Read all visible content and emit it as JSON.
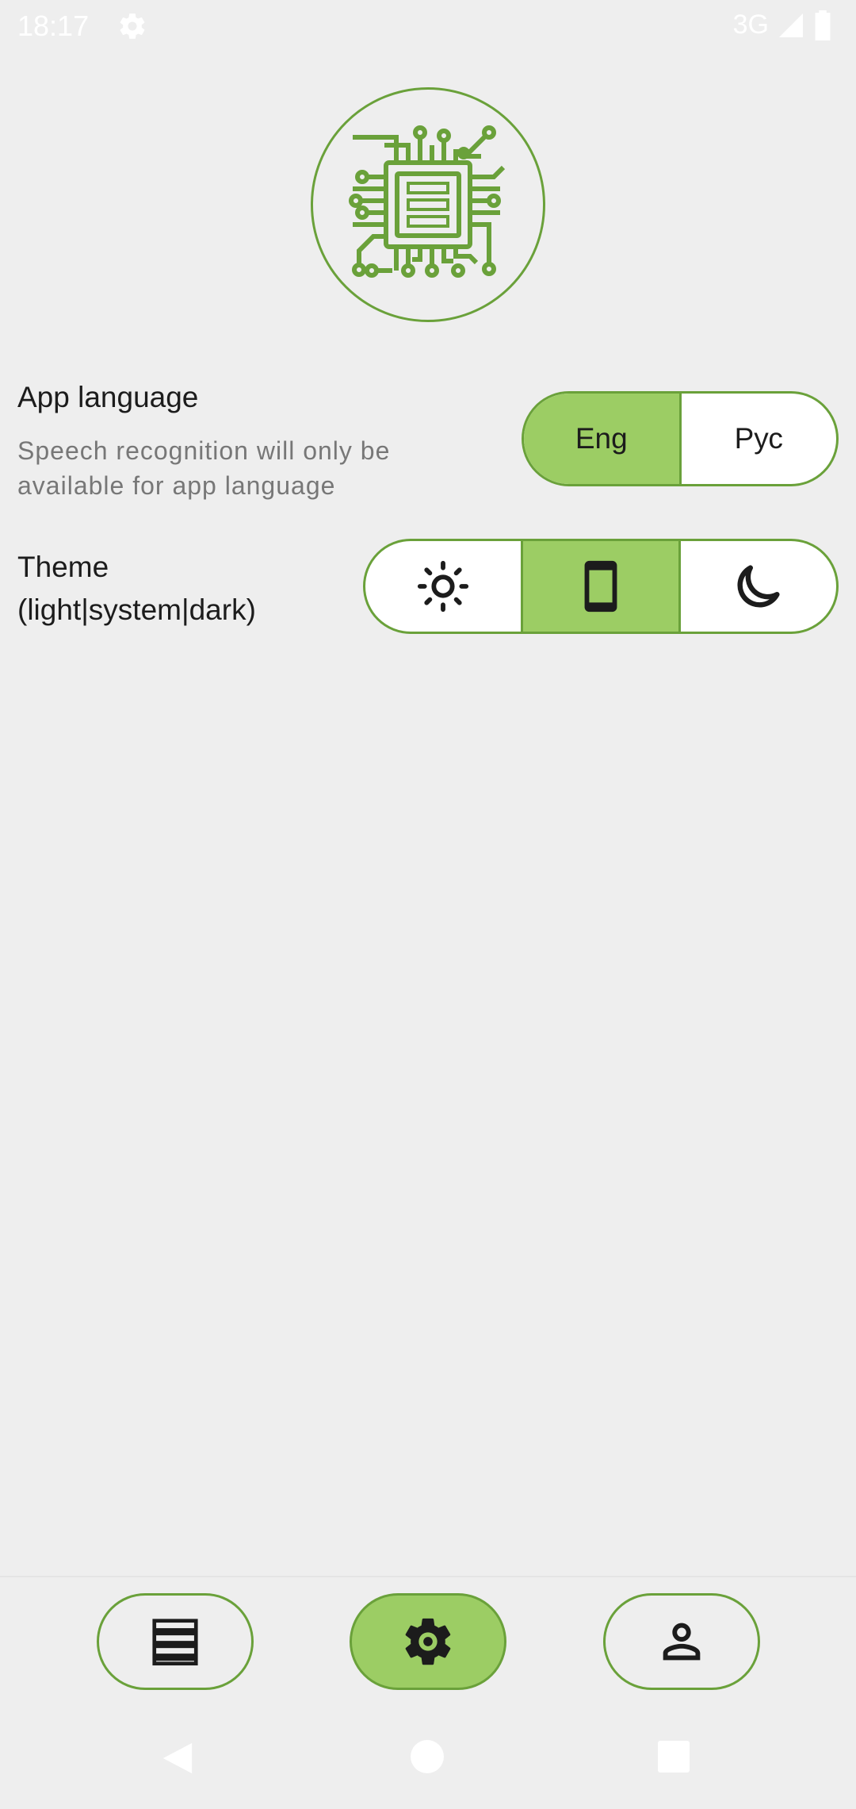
{
  "status_bar": {
    "time": "18:17",
    "settings_icon": "gear-icon",
    "network": "3G",
    "signal_icon": "signal-icon",
    "battery_icon": "battery-icon"
  },
  "logo": {
    "icon": "circuit-chip-icon",
    "color": "#6aa13a"
  },
  "settings": {
    "language": {
      "title": "App language",
      "subtitle": "Speech recognition will only be available for app language",
      "options": [
        "Eng",
        "Рус"
      ],
      "selected": "Eng"
    },
    "theme": {
      "title": "Theme (light|system|dark)",
      "options": [
        {
          "icon": "sun-icon"
        },
        {
          "icon": "phone-icon"
        },
        {
          "icon": "moon-icon"
        }
      ],
      "selected_index": 1
    }
  },
  "bottom_nav": {
    "items": [
      {
        "icon": "list-icon"
      },
      {
        "icon": "gear-icon"
      },
      {
        "icon": "person-icon"
      }
    ],
    "active_index": 1
  },
  "colors": {
    "accent": "#9ccd64",
    "border": "#6aa13a",
    "background": "#eeeeee"
  }
}
